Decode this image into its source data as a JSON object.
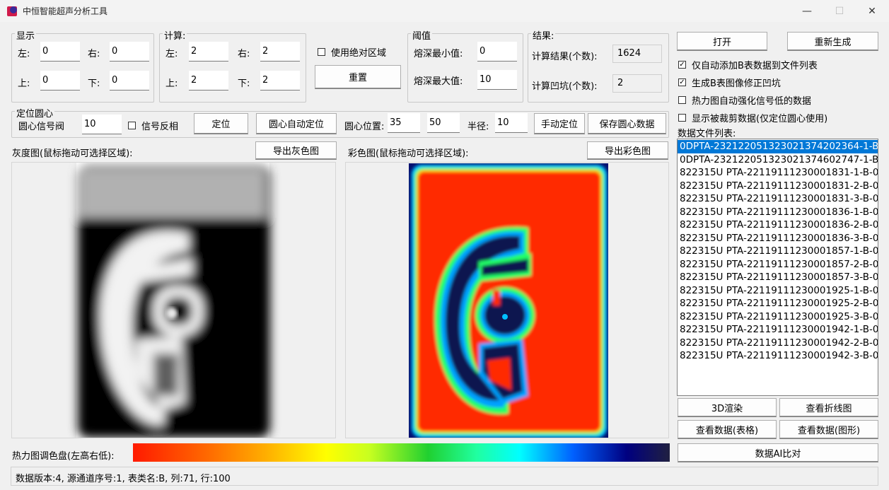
{
  "window": {
    "title": "中恒智能超声分析工具",
    "minimize": "—",
    "maximize": "☐",
    "close": "✕"
  },
  "display": {
    "title": "显示",
    "left_label": "左:",
    "left": "0",
    "right_label": "右:",
    "right": "0",
    "top_label": "上:",
    "top": "0",
    "bottom_label": "下:",
    "bottom": "0"
  },
  "calc": {
    "title": "计算:",
    "left_label": "左:",
    "left": "2",
    "right_label": "右:",
    "right": "2",
    "top_label": "上:",
    "top": "2",
    "bottom_label": "下:",
    "bottom": "2"
  },
  "abs_region": {
    "label": "使用绝对区域",
    "checked": false
  },
  "reset_label": "重置",
  "threshold": {
    "title": "阈值",
    "min_label": "熔深最小值:",
    "min": "0",
    "max_label": "熔深最大值:",
    "max": "10"
  },
  "result": {
    "title": "结果:",
    "count_label": "计算结果(个数):",
    "count": "1624",
    "pits_label": "计算凹坑(个数):",
    "pits": "2"
  },
  "buttons": {
    "open": "打开",
    "regen": "重新生成",
    "render3d": "3D渲染",
    "line": "查看折线图",
    "table": "查看数据(表格)",
    "graph": "查看数据(图形)",
    "ai": "数据AI比对"
  },
  "options": [
    {
      "label": "仅自动添加B表数据到文件列表",
      "checked": true
    },
    {
      "label": "生成B表图像修正凹坑",
      "checked": true
    },
    {
      "label": "热力图自动强化信号低的数据",
      "checked": false
    },
    {
      "label": "显示被裁剪数据(仅定位圆心使用)",
      "checked": false
    }
  ],
  "locate": {
    "title": "定位圆心",
    "signal_label": "圆心信号阀",
    "signal": "10",
    "invert_label": "信号反相",
    "locate_btn": "定位",
    "auto_btn": "圆心自动定位",
    "pos_label": "圆心位置:",
    "pos_x": "35",
    "pos_y": "50",
    "radius_label": "半径:",
    "radius": "10",
    "manual_btn": "手动定位",
    "save_btn": "保存圆心数据"
  },
  "gray": {
    "label": "灰度图(鼠标拖动可选择区域):",
    "export": "导出灰色图"
  },
  "color": {
    "label": "彩色图(鼠标拖动可选择区域):",
    "export": "导出彩色图"
  },
  "palette_label": "热力图调色盘(左高右低):",
  "file_list_label": "数据文件列表:",
  "files": [
    "0DPTA-2321220513230213742023​64-1-B-0",
    "0DPTA-2321220513230213746027​47-1-B-0",
    "822315U PTA-22119111230001831-1-B-0",
    "822315U PTA-22119111230001831-2-B-0",
    "822315U PTA-22119111230001831-3-B-0",
    "822315U PTA-22119111230001836-1-B-0",
    "822315U PTA-22119111230001836-2-B-0",
    "822315U PTA-22119111230001836-3-B-0",
    "822315U PTA-22119111230001857-1-B-0",
    "822315U PTA-22119111230001857-2-B-0",
    "822315U PTA-22119111230001857-3-B-0",
    "822315U PTA-22119111230001925-1-B-0",
    "822315U PTA-22119111230001925-2-B-0",
    "822315U PTA-22119111230001925-3-B-0",
    "822315U PTA-22119111230001942-1-B-0",
    "822315U PTA-22119111230001942-2-B-0",
    "822315U PTA-22119111230001942-3-B-0"
  ],
  "selected_file_index": 0,
  "status": "数据版本:4, 源通道序号:1, 表类名:B, 列:71, 行:100",
  "colors": {
    "selection": "#0078d7",
    "heat_high": "#ff2a00",
    "heat_low": "#0a0a40"
  }
}
